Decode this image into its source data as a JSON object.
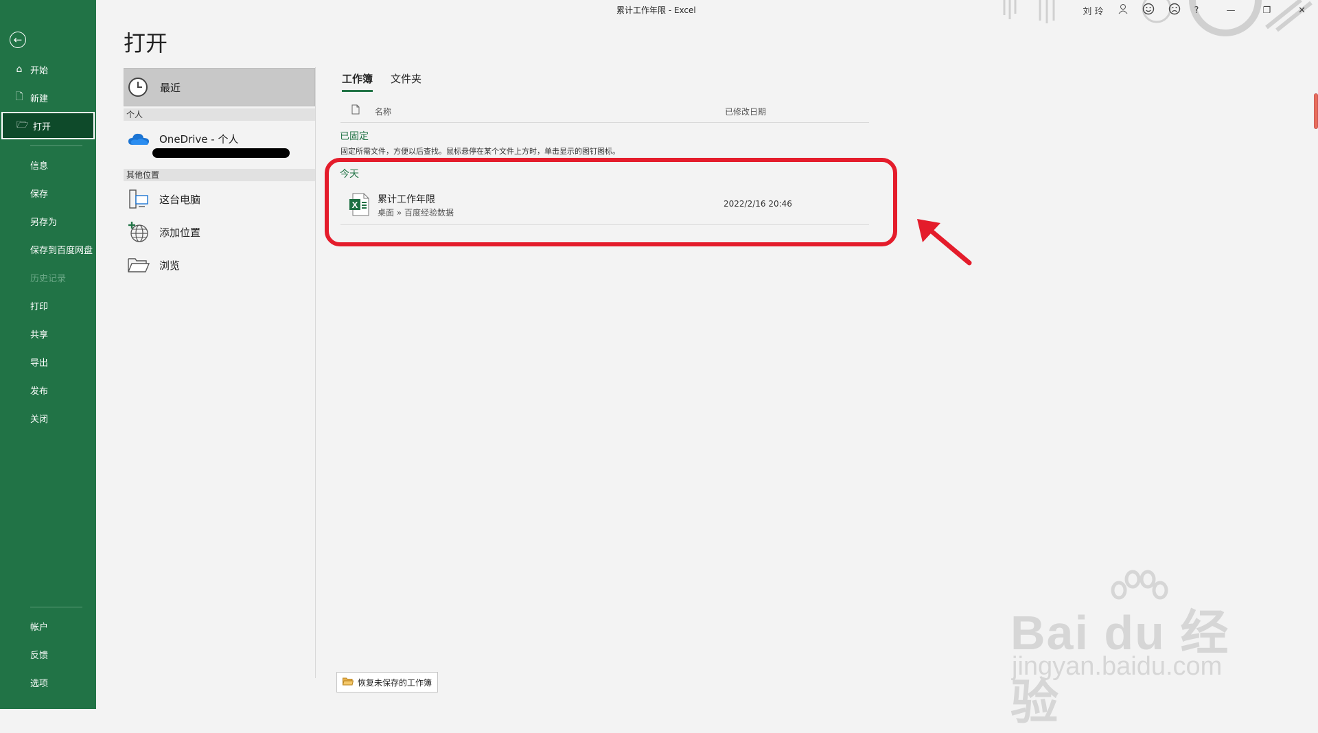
{
  "window": {
    "title": "累计工作年限  -  Excel"
  },
  "topbar": {
    "user": "刘 玲",
    "help": "?",
    "minimize": "—",
    "restore": "❐",
    "close": "✕"
  },
  "nav": {
    "items": [
      {
        "label": "开始",
        "icon": "home-icon"
      },
      {
        "label": "新建",
        "icon": "new-doc-icon"
      },
      {
        "label": "打开",
        "icon": "open-folder-icon"
      },
      {
        "label": "信息"
      },
      {
        "label": "保存"
      },
      {
        "label": "另存为"
      },
      {
        "label": "保存到百度网盘"
      },
      {
        "label": "历史记录"
      },
      {
        "label": "打印"
      },
      {
        "label": "共享"
      },
      {
        "label": "导出"
      },
      {
        "label": "发布"
      },
      {
        "label": "关闭"
      }
    ],
    "bottom": [
      {
        "label": "帐户"
      },
      {
        "label": "反馈"
      },
      {
        "label": "选项"
      }
    ]
  },
  "page": {
    "title": "打开"
  },
  "locations": {
    "recent": "最近",
    "personal_header": "个人",
    "onedrive": "OneDrive - 个人",
    "other_header": "其他位置",
    "this_pc": "这台电脑",
    "add_place": "添加位置",
    "browse": "浏览"
  },
  "files": {
    "tabs": [
      "工作簿",
      "文件夹"
    ],
    "header_name": "名称",
    "header_date": "已修改日期",
    "pinned_label": "已固定",
    "pinned_desc": "固定所需文件，方便以后查找。鼠标悬停在某个文件上方时，单击显示的图钉图标。",
    "today_label": "今天",
    "items": [
      {
        "name": "累计工作年限",
        "path": "桌面 » 百度经验数据",
        "date": "2022/2/16 20:46"
      }
    ]
  },
  "recover_button": "恢复未保存的工作簿",
  "watermark": {
    "main": "Bai du 经验",
    "sub": "jingyan.baidu.com"
  },
  "colors": {
    "excel_green": "#217346",
    "highlight_red": "#e41c2b"
  }
}
